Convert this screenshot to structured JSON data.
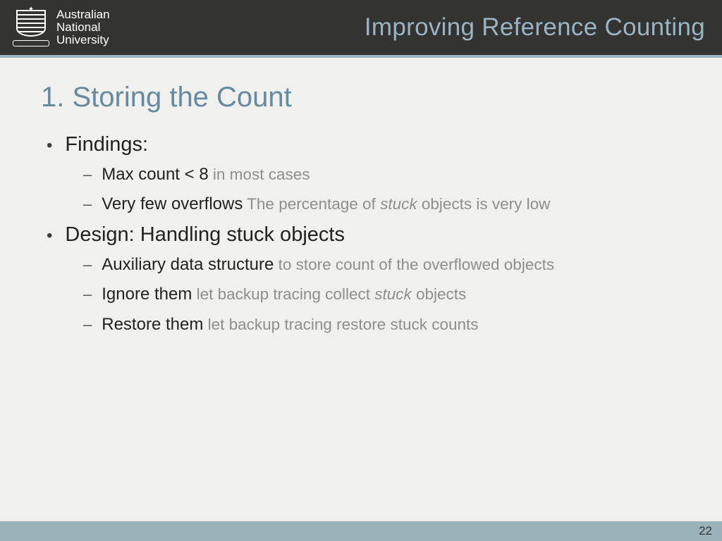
{
  "header": {
    "university_line1": "Australian",
    "university_line2": "National",
    "university_line3": "University",
    "topic": "Improving Reference Counting"
  },
  "title": "1. Storing the Count",
  "content": {
    "items": [
      {
        "text": "Findings:",
        "children": [
          {
            "main": "Max count < 8",
            "sub_plain": " in most cases",
            "sub_italic": ""
          },
          {
            "main": "Very few overflows",
            "sub_prefix": " The percentage of ",
            "sub_italic": "stuck",
            "sub_suffix": " objects is very low"
          }
        ]
      },
      {
        "text": "Design: Handling stuck objects",
        "children": [
          {
            "main": "Auxiliary data structure",
            "sub_plain": " to store count of the overflowed objects",
            "sub_italic": ""
          },
          {
            "main": "Ignore them",
            "sub_prefix": " let backup tracing collect ",
            "sub_italic": "stuck",
            "sub_suffix": " objects"
          },
          {
            "main": "Restore them",
            "sub_plain": " let backup tracing restore stuck counts",
            "sub_italic": ""
          }
        ]
      }
    ]
  },
  "footer": {
    "page_number": "22"
  }
}
